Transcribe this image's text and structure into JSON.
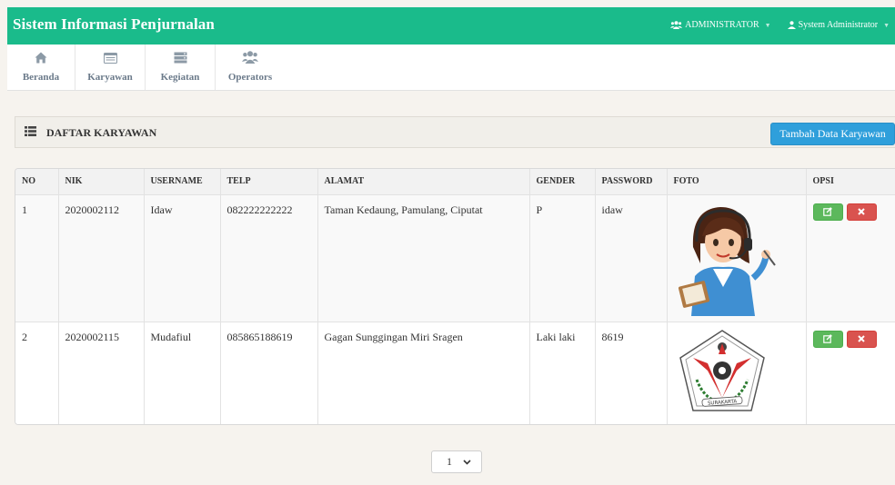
{
  "app": {
    "title": "Sistem Informasi Penjurnalan",
    "menu_role": "ADMINISTRATOR",
    "menu_user": "System Administrator"
  },
  "nav": {
    "items": [
      {
        "label": "Beranda",
        "icon": "home-icon"
      },
      {
        "label": "Karyawan",
        "icon": "list-icon"
      },
      {
        "label": "Kegiatan",
        "icon": "server-icon"
      },
      {
        "label": "Operators",
        "icon": "users-icon"
      }
    ]
  },
  "panel": {
    "title": "DAFTAR KARYAWAN",
    "add_button": "Tambah Data Karyawan"
  },
  "table": {
    "headers": [
      "NO",
      "NIK",
      "USERNAME",
      "TELP",
      "ALAMAT",
      "GENDER",
      "PASSWORD",
      "FOTO",
      "OPSI"
    ],
    "rows": [
      {
        "no": "1",
        "nik": "2020002112",
        "username": "Idaw",
        "telp": "082222222222",
        "alamat": "Taman Kedaung, Pamulang, Ciputat",
        "gender": "P",
        "password": "idaw",
        "foto": "operator-illustration"
      },
      {
        "no": "2",
        "nik": "2020002115",
        "username": "Mudafiul",
        "telp": "085865188619",
        "alamat": "Gagan Sunggingan Miri Sragen",
        "gender": "Laki laki",
        "password": "8619",
        "foto": "surakarta-emblem"
      }
    ],
    "emblem_text": "SURAKARTA"
  },
  "pagination": {
    "selected": "1"
  },
  "colors": {
    "topbar": "#1abb8b",
    "primary_button": "#2f9fdb",
    "edit_button": "#5cb85c",
    "delete_button": "#d9534f"
  }
}
